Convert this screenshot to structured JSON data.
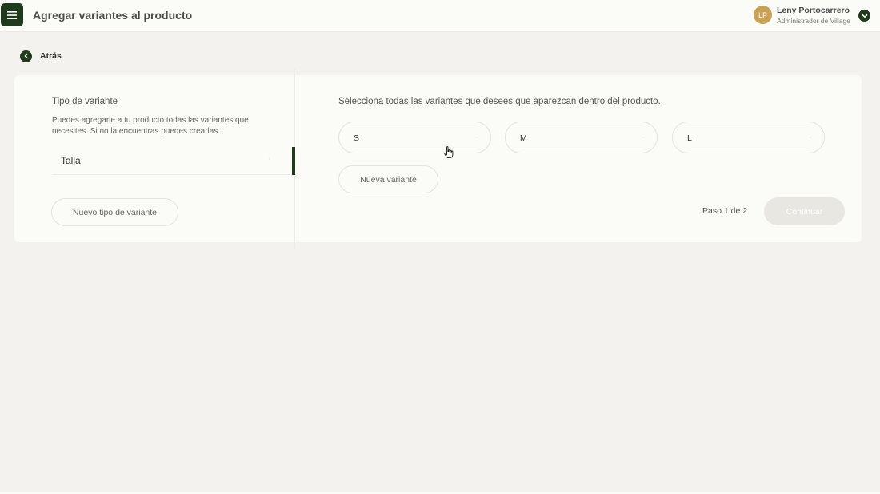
{
  "header": {
    "title": "Agregar variantes al producto",
    "menu_icon": "hamburger-icon",
    "user": {
      "initials": "LP",
      "name": "Leny Portocarrero",
      "role": "Administrador de Village",
      "toggle_icon": "chevron-down-icon"
    }
  },
  "back": {
    "label": "Atrás",
    "icon": "chevron-left-icon"
  },
  "left_panel": {
    "title": "Tipo de variante",
    "description": "Puedes agregarle a tu producto todas las variantes que necesites. Si no la encuentras puedes crearlas.",
    "variant_types": [
      {
        "label": "Talla",
        "selected": true
      }
    ],
    "new_type_button": "Nuevo tipo de variante"
  },
  "right_panel": {
    "instruction": "Selecciona todas las variantes que desees que aparezcan dentro del producto.",
    "options": [
      {
        "label": "S"
      },
      {
        "label": "M"
      },
      {
        "label": "L"
      }
    ],
    "new_variant_button": "Nueva variante",
    "step": "Paso 1 de 2",
    "continue_button": "Continuar"
  },
  "colors": {
    "primary": "#1f3a1c",
    "avatar": "#c9a255",
    "background": "#f3f2ef",
    "surface": "#fbfbf8"
  }
}
